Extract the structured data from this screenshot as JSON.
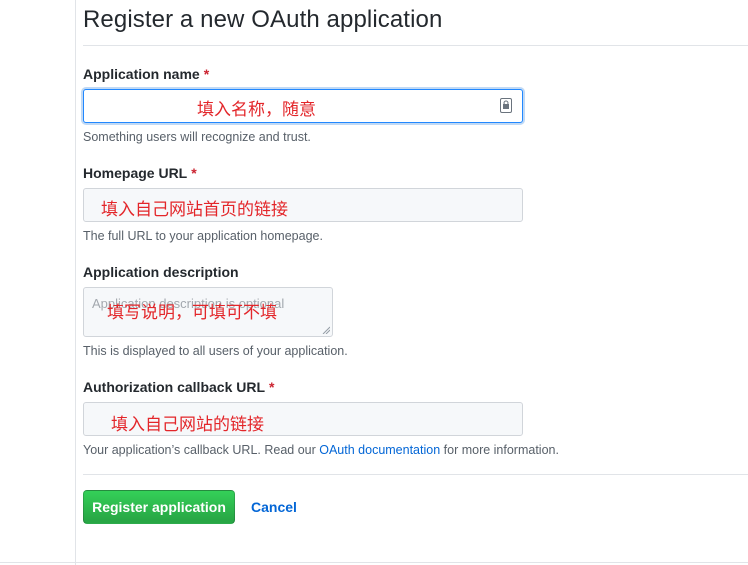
{
  "page": {
    "title": "Register a new OAuth application"
  },
  "fields": {
    "app_name": {
      "label": "Application name",
      "required_mark": "*",
      "annotation": "填入名称，随意",
      "help": "Something users will recognize and trust."
    },
    "homepage": {
      "label": "Homepage URL",
      "required_mark": "*",
      "annotation": "填入自己网站首页的链接",
      "help": "The full URL to your application homepage."
    },
    "description": {
      "label": "Application description",
      "placeholder": "Application description is optional",
      "annotation": "填写说明，可填可不填",
      "help": "This is displayed to all users of your application."
    },
    "callback": {
      "label": "Authorization callback URL",
      "required_mark": "*",
      "annotation": "填入自己网站的链接",
      "help_prefix": "Your application’s callback URL. Read our ",
      "help_link": "OAuth documentation",
      "help_suffix": " for more information."
    }
  },
  "actions": {
    "register_label": "Register application",
    "cancel_label": "Cancel"
  },
  "colors": {
    "primary_green": "#28a745",
    "link_blue": "#0366d6",
    "annotation_red": "#e3262a",
    "required_red": "#cb2431"
  },
  "icons": {
    "password_manager": "password-manager-icon",
    "resize": "resize-grip-icon"
  }
}
